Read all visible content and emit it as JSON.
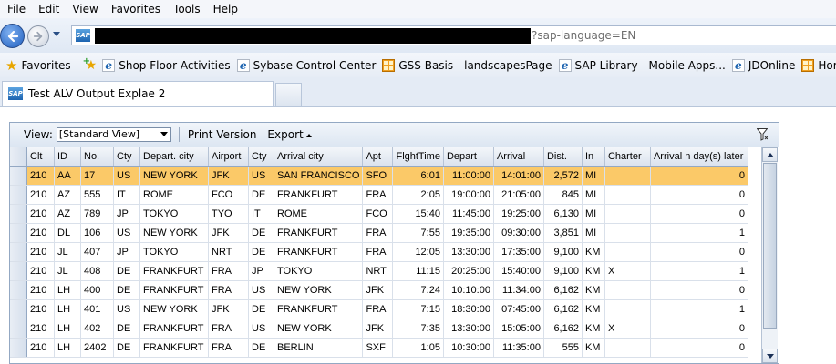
{
  "menu": [
    "File",
    "Edit",
    "View",
    "Favorites",
    "Tools",
    "Help"
  ],
  "address": {
    "url_suffix": "?sap-language=EN",
    "favicon_text": "SAP"
  },
  "favorites": {
    "label": "Favorites",
    "links": [
      {
        "label": "Shop Floor Activities",
        "icon": "ie-page-icon"
      },
      {
        "label": "Sybase Control Center",
        "icon": "ie-page-icon"
      },
      {
        "label": "GSS Basis - landscapesPage",
        "icon": "grid-app-icon"
      },
      {
        "label": "SAP Library - Mobile Apps...",
        "icon": "ie-page-icon"
      },
      {
        "label": "JDOnline",
        "icon": "ie-page-icon"
      },
      {
        "label": "Home - Globa",
        "icon": "grid-app-icon"
      }
    ]
  },
  "tab": {
    "title": "Test ALV Output Explae 2"
  },
  "toolbar": {
    "view_label": "View:",
    "view_value": "[Standard View]",
    "print_label": "Print Version",
    "export_label": "Export"
  },
  "columns": [
    "Clt",
    "ID",
    "No.",
    "Cty",
    "Depart. city",
    "Airport",
    "Cty",
    "Arrival city",
    "Apt",
    "FlghtTime",
    "Depart",
    "Arrival",
    "Dist.",
    "In",
    "Charter",
    "Arrival n day(s) later"
  ],
  "rows": [
    [
      "210",
      "AA",
      "17",
      "US",
      "NEW YORK",
      "JFK",
      "US",
      "SAN FRANCISCO",
      "SFO",
      "6:01",
      "11:00:00",
      "14:01:00",
      "2,572",
      "MI",
      "",
      "0"
    ],
    [
      "210",
      "AZ",
      "555",
      "IT",
      "ROME",
      "FCO",
      "DE",
      "FRANKFURT",
      "FRA",
      "2:05",
      "19:00:00",
      "21:05:00",
      "845",
      "MI",
      "",
      "0"
    ],
    [
      "210",
      "AZ",
      "789",
      "JP",
      "TOKYO",
      "TYO",
      "IT",
      "ROME",
      "FCO",
      "15:40",
      "11:45:00",
      "19:25:00",
      "6,130",
      "MI",
      "",
      "0"
    ],
    [
      "210",
      "DL",
      "106",
      "US",
      "NEW YORK",
      "JFK",
      "DE",
      "FRANKFURT",
      "FRA",
      "7:55",
      "19:35:00",
      "09:30:00",
      "3,851",
      "MI",
      "",
      "1"
    ],
    [
      "210",
      "JL",
      "407",
      "JP",
      "TOKYO",
      "NRT",
      "DE",
      "FRANKFURT",
      "FRA",
      "12:05",
      "13:30:00",
      "17:35:00",
      "9,100",
      "KM",
      "",
      "0"
    ],
    [
      "210",
      "JL",
      "408",
      "DE",
      "FRANKFURT",
      "FRA",
      "JP",
      "TOKYO",
      "NRT",
      "11:15",
      "20:25:00",
      "15:40:00",
      "9,100",
      "KM",
      "X",
      "1"
    ],
    [
      "210",
      "LH",
      "400",
      "DE",
      "FRANKFURT",
      "FRA",
      "US",
      "NEW YORK",
      "JFK",
      "7:24",
      "10:10:00",
      "11:34:00",
      "6,162",
      "KM",
      "",
      "0"
    ],
    [
      "210",
      "LH",
      "401",
      "US",
      "NEW YORK",
      "JFK",
      "DE",
      "FRANKFURT",
      "FRA",
      "7:15",
      "18:30:00",
      "07:45:00",
      "6,162",
      "KM",
      "",
      "1"
    ],
    [
      "210",
      "LH",
      "402",
      "DE",
      "FRANKFURT",
      "FRA",
      "US",
      "NEW YORK",
      "JFK",
      "7:35",
      "13:30:00",
      "15:05:00",
      "6,162",
      "KM",
      "X",
      "0"
    ],
    [
      "210",
      "LH",
      "2402",
      "DE",
      "FRANKFURT",
      "FRA",
      "DE",
      "BERLIN",
      "SXF",
      "1:05",
      "10:30:00",
      "11:35:00",
      "555",
      "KM",
      "",
      "0"
    ]
  ],
  "selected_row": 0,
  "colors": {
    "selected_row": "#fbc968",
    "header_bg": "#dbe3ee",
    "border": "#93a8c3"
  }
}
